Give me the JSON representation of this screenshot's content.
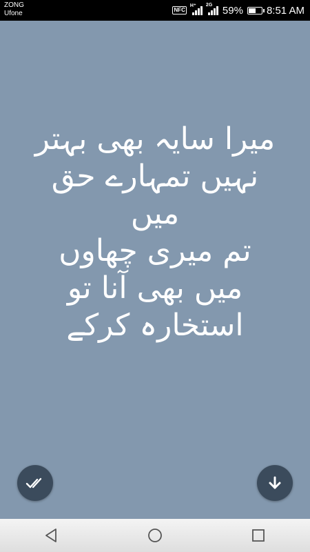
{
  "status_bar": {
    "carrier_1": "ZONG",
    "carrier_2": "Ufone",
    "nfc_label": "NFC",
    "signal_1_tag": "H⁺",
    "signal_2_tag": "2G",
    "battery_percent": "59%",
    "battery_level": 0.59,
    "time": "8:51 AM"
  },
  "poem": {
    "lines": [
      "میرا سایہ بھی بہتر",
      "نہیں تمہارے حق",
      "میں",
      "تم میری چھاوں",
      "میں بھی آنا تو",
      "استخارہ کرکے"
    ]
  },
  "buttons": {
    "left": {
      "icon": "double-check-icon"
    },
    "right": {
      "icon": "download-arrow-icon"
    }
  },
  "nav": {
    "back": "back-triangle-icon",
    "home": "home-circle-icon",
    "recents": "recents-square-icon"
  },
  "colors": {
    "background": "#8398ae",
    "fab": "#3b4b5c",
    "text": "#ffffff"
  }
}
